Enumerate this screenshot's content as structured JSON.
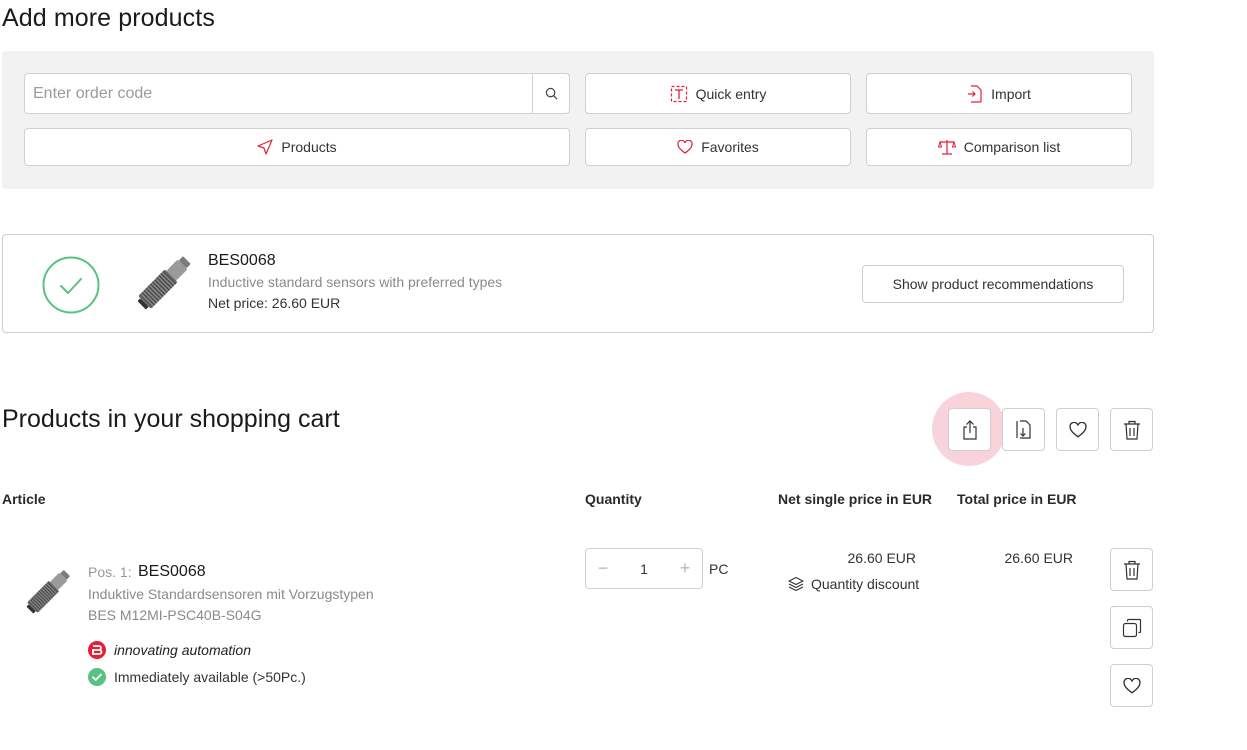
{
  "add_section": {
    "title": "Add more products",
    "search_placeholder": "Enter order code",
    "quick_entry": "Quick entry",
    "import": "Import",
    "products": "Products",
    "favorites": "Favorites",
    "comparison": "Comparison list"
  },
  "added_product": {
    "code": "BES0068",
    "description": "Inductive standard sensors with preferred types",
    "price": "Net price: 26.60 EUR",
    "recommend_button": "Show product recommendations"
  },
  "cart": {
    "title": "Products in your shopping cart",
    "columns": {
      "article": "Article",
      "quantity": "Quantity",
      "single": "Net single price in EUR",
      "total": "Total price in EUR"
    },
    "item": {
      "pos_label": "Pos. 1:",
      "code": "BES0068",
      "description": "Induktive Standardsensoren mit Vorzugstypen",
      "type": "BES M12MI-PSC40B-S04G",
      "brand": "innovating automation",
      "availability": "Immediately available (>50Pc.)",
      "quantity": "1",
      "minus": "−",
      "plus": "+",
      "unit": "PC",
      "single_price": "26.60 EUR",
      "discount": "Quantity discount",
      "total_price": "26.60 EUR"
    }
  },
  "colors": {
    "accent": "#e2203c",
    "success": "#5bc17f",
    "halo": "#f9d3dc"
  },
  "icons": {
    "search": "search-icon",
    "quick_entry": "text-cursor-icon",
    "import": "file-import-icon",
    "products": "navigation-arrow-icon",
    "favorites": "heart-icon",
    "comparison": "scales-icon",
    "share": "share-icon",
    "export": "file-export-icon",
    "favorite_cart": "heart-icon",
    "delete_cart": "trash-icon",
    "delete_item": "trash-icon",
    "copy_item": "copy-icon",
    "favorite_item": "heart-icon",
    "discount": "layers-icon",
    "added": "check-circle-icon",
    "availability": "check-circle-icon",
    "brand": "balluff-logo-icon"
  }
}
